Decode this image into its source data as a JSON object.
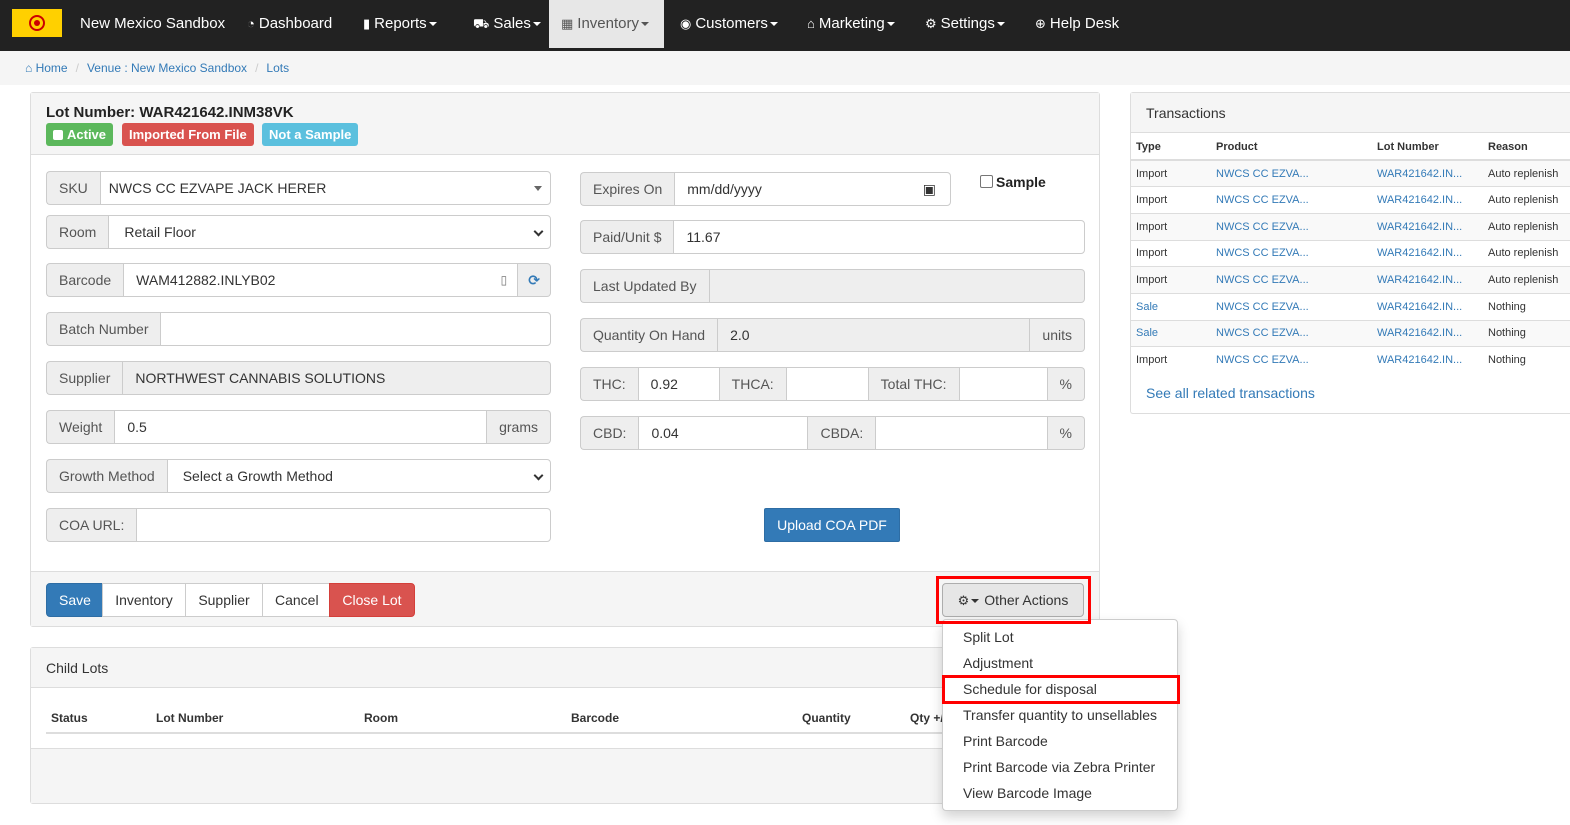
{
  "navbar": {
    "brand": "New Mexico Sandbox",
    "items": [
      {
        "label": "Dashboard",
        "icon": "dashboard-icon",
        "glyph": "◔",
        "dropdown": false
      },
      {
        "label": "Reports",
        "icon": "bar-chart-icon",
        "glyph": "▮",
        "dropdown": true
      },
      {
        "label": "Sales",
        "icon": "cart-icon",
        "glyph": "⛟",
        "dropdown": true
      },
      {
        "label": "Inventory",
        "icon": "grid-icon",
        "glyph": "▦",
        "dropdown": true,
        "active": true
      },
      {
        "label": "Customers",
        "icon": "user-circle-icon",
        "glyph": "◉",
        "dropdown": true
      },
      {
        "label": "Marketing",
        "icon": "gift-icon",
        "glyph": "⌂",
        "dropdown": true
      },
      {
        "label": "Settings",
        "icon": "gears-icon",
        "glyph": "⚙",
        "dropdown": true
      },
      {
        "label": "Help Desk",
        "icon": "lifebuoy-icon",
        "glyph": "⊕",
        "dropdown": false
      }
    ]
  },
  "breadcrumb": {
    "home": "Home",
    "venue": "Venue : New Mexico Sandbox",
    "lots": "Lots"
  },
  "lot": {
    "title": "Lot Number: WAR421642.INM38VK",
    "badges": {
      "active": "Active",
      "imported": "Imported From File",
      "sample": "Not a Sample"
    }
  },
  "form": {
    "sku": {
      "label": "SKU",
      "value": "NWCS CC EZVAPE JACK HERER"
    },
    "room": {
      "label": "Room",
      "value": "Retail Floor"
    },
    "barcode": {
      "label": "Barcode",
      "value": "WAM412882.INLYB02"
    },
    "batch": {
      "label": "Batch Number",
      "value": ""
    },
    "supplier": {
      "label": "Supplier",
      "value": "NORTHWEST CANNABIS SOLUTIONS"
    },
    "weight": {
      "label": "Weight",
      "value": "0.5",
      "unit": "grams"
    },
    "growth": {
      "label": "Growth Method",
      "value": "Select a Growth Method"
    },
    "coa_url": {
      "label": "COA URL:",
      "value": ""
    },
    "expires": {
      "label": "Expires On",
      "value": "mm/dd/yyyy"
    },
    "sample": {
      "label": "Sample",
      "checked": false
    },
    "paid": {
      "label": "Paid/Unit $",
      "value": "11.67"
    },
    "last_updated": {
      "label": "Last Updated By",
      "value": ""
    },
    "qoh": {
      "label": "Quantity On Hand",
      "value": "2.0",
      "unit": "units"
    },
    "thc": {
      "label": "THC:",
      "value": "0.92"
    },
    "thca": {
      "label": "THCA:",
      "value": ""
    },
    "total_thc": {
      "label": "Total THC:",
      "value": "",
      "unit": "%"
    },
    "cbd": {
      "label": "CBD:",
      "value": "0.04"
    },
    "cbda": {
      "label": "CBDA:",
      "value": "",
      "unit": "%"
    },
    "upload_coa": "Upload COA PDF"
  },
  "actions": {
    "save": "Save",
    "inventory": "Inventory",
    "supplier": "Supplier",
    "cancel": "Cancel",
    "close_lot": "Close Lot",
    "other_actions": "Other Actions"
  },
  "other_actions_menu": [
    "Split Lot",
    "Adjustment",
    "Schedule for disposal",
    "Transfer quantity to unsellables",
    "Print Barcode",
    "Print Barcode via Zebra Printer",
    "View Barcode Image"
  ],
  "child_lots": {
    "title": "Child Lots",
    "columns": [
      "Status",
      "Lot Number",
      "Room",
      "Barcode",
      "Quantity",
      "Qty +/"
    ]
  },
  "transactions": {
    "title": "Transactions",
    "columns": [
      "Type",
      "Product",
      "Lot Number",
      "Reason"
    ],
    "rows": [
      {
        "type": "Import",
        "type_link": false,
        "product": "NWCS CC EZVA...",
        "lot": "WAR421642.IN...",
        "reason": "Auto replenish"
      },
      {
        "type": "Import",
        "type_link": false,
        "product": "NWCS CC EZVA...",
        "lot": "WAR421642.IN...",
        "reason": "Auto replenish"
      },
      {
        "type": "Import",
        "type_link": false,
        "product": "NWCS CC EZVA...",
        "lot": "WAR421642.IN...",
        "reason": "Auto replenish"
      },
      {
        "type": "Import",
        "type_link": false,
        "product": "NWCS CC EZVA...",
        "lot": "WAR421642.IN...",
        "reason": "Auto replenish"
      },
      {
        "type": "Import",
        "type_link": false,
        "product": "NWCS CC EZVA...",
        "lot": "WAR421642.IN...",
        "reason": "Auto replenish"
      },
      {
        "type": "Sale",
        "type_link": true,
        "product": "NWCS CC EZVA...",
        "lot": "WAR421642.IN...",
        "reason": "Nothing"
      },
      {
        "type": "Sale",
        "type_link": true,
        "product": "NWCS CC EZVA...",
        "lot": "WAR421642.IN...",
        "reason": "Nothing"
      },
      {
        "type": "Import",
        "type_link": false,
        "product": "NWCS CC EZVA...",
        "lot": "WAR421642.IN...",
        "reason": "Nothing"
      }
    ],
    "see_all": "See all related transactions"
  },
  "colors": {
    "navbar": "#222222",
    "primary": "#337ab7",
    "success": "#5cb85c",
    "danger": "#d9534f",
    "info": "#5bc0de",
    "highlight": "#ff0000"
  }
}
